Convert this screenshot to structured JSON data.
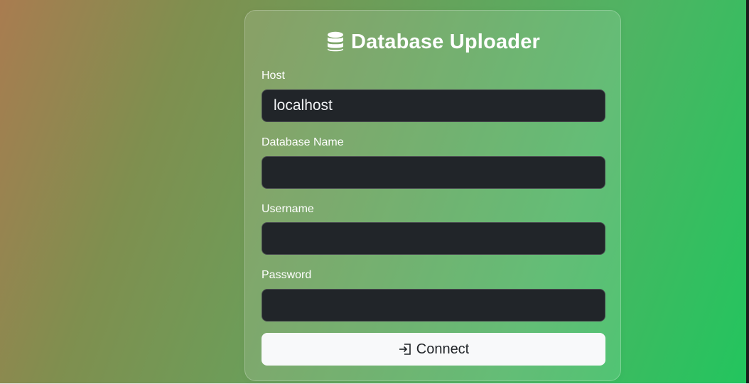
{
  "app": {
    "title": "Database Uploader",
    "title_icon": "database-icon"
  },
  "form": {
    "host": {
      "label": "Host",
      "value": "localhost"
    },
    "database_name": {
      "label": "Database Name",
      "value": ""
    },
    "username": {
      "label": "Username",
      "value": ""
    },
    "password": {
      "label": "Password",
      "value": ""
    },
    "submit": {
      "label": "Connect",
      "icon": "login-icon"
    }
  },
  "colors": {
    "input_background": "#212529",
    "button_background": "#f8f9fa",
    "gradient_start": "#a97c50",
    "gradient_end": "#22c55e"
  }
}
